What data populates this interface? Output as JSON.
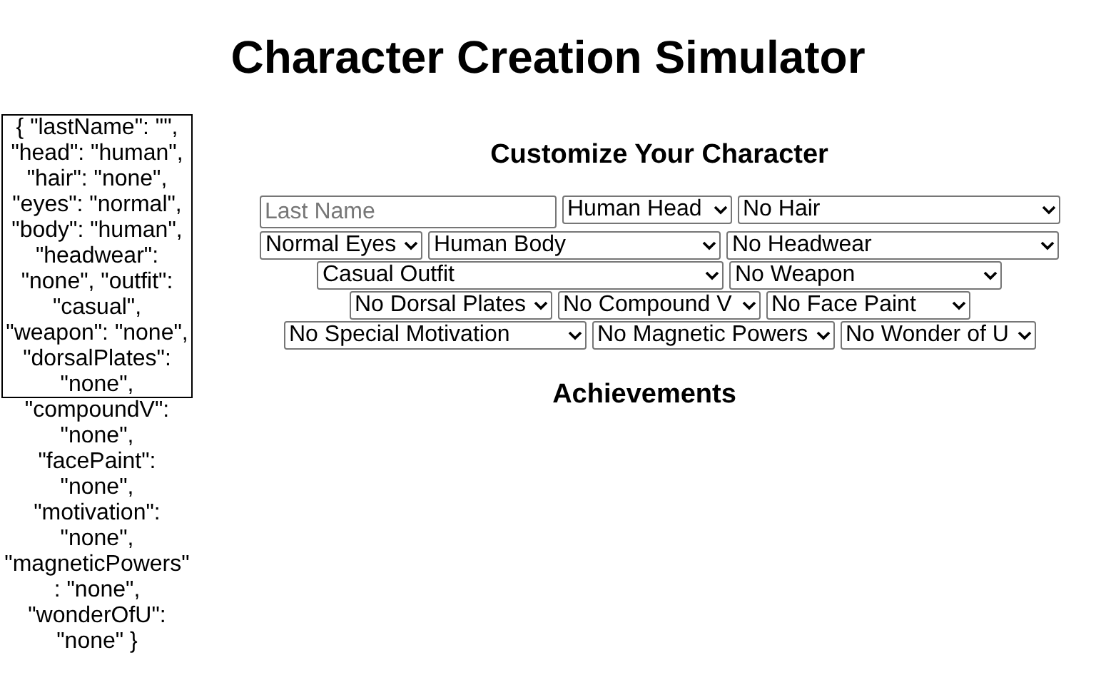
{
  "title": "Character Creation Simulator",
  "state_dump": "{ \"lastName\": \"\", \"head\": \"human\", \"hair\": \"none\", \"eyes\": \"normal\", \"body\": \"human\", \"headwear\": \"none\", \"outfit\": \"casual\", \"weapon\": \"none\", \"dorsalPlates\": \"none\", \"compoundV\": \"none\", \"facePaint\": \"none\", \"motivation\": \"none\", \"magneticPowers\": \"none\", \"wonderOfU\": \"none\" }",
  "customize": {
    "heading": "Customize Your Character",
    "rows": [
      [
        {
          "kind": "input",
          "placeholder": "Last Name"
        },
        {
          "kind": "select",
          "value": "Human Head"
        },
        {
          "kind": "select",
          "value": "No Hair"
        }
      ],
      [
        {
          "kind": "select",
          "value": "Normal Eyes"
        },
        {
          "kind": "select",
          "value": "Human Body"
        },
        {
          "kind": "select",
          "value": "No Headwear"
        }
      ],
      [
        {
          "kind": "select",
          "value": "Casual Outfit"
        },
        {
          "kind": "select",
          "value": "No Weapon"
        }
      ],
      [
        {
          "kind": "select",
          "value": "No Dorsal Plates"
        },
        {
          "kind": "select",
          "value": "No Compound V"
        },
        {
          "kind": "select",
          "value": "No Face Paint"
        }
      ],
      [
        {
          "kind": "select",
          "value": "No Special Motivation"
        },
        {
          "kind": "select",
          "value": "No Magnetic Powers"
        },
        {
          "kind": "select",
          "value": "No Wonder of U"
        }
      ]
    ]
  },
  "achievements": {
    "heading": "Achievements"
  }
}
